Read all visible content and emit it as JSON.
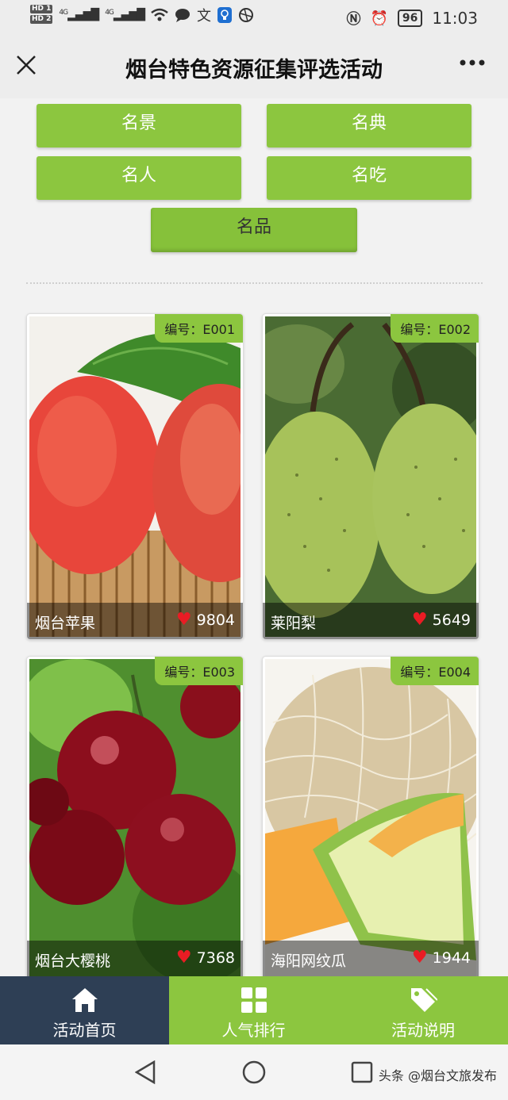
{
  "status_bar": {
    "hd1": "HD 1",
    "hd2": "HD 2",
    "net1": "4G",
    "net2": "4G",
    "battery": "96",
    "time": "11:03"
  },
  "header": {
    "title": "烟台特色资源征集评选活动",
    "close_icon": "close-icon",
    "more_icon": "more-icon"
  },
  "categories": [
    {
      "label": "名景"
    },
    {
      "label": "名典"
    },
    {
      "label": "名人"
    },
    {
      "label": "名吃"
    },
    {
      "label": "名品"
    }
  ],
  "items": [
    {
      "code": "编号：E001",
      "name": "烟台苹果",
      "votes": "9804"
    },
    {
      "code": "编号：E002",
      "name": "莱阳梨",
      "votes": "5649"
    },
    {
      "code": "编号：E003",
      "name": "烟台大樱桃",
      "votes": "7368"
    },
    {
      "code": "编号：E004",
      "name": "海阳网纹瓜",
      "votes": "1944"
    }
  ],
  "tabs": [
    {
      "label": "活动首页",
      "icon": "home-icon"
    },
    {
      "label": "人气排行",
      "icon": "grid-icon"
    },
    {
      "label": "活动说明",
      "icon": "tag-icon"
    }
  ],
  "colors": {
    "accent": "#8cc63f",
    "active_tab": "#2e3f55",
    "heart": "#ea1c24"
  },
  "watermark": "头条 @烟台文旅发布"
}
